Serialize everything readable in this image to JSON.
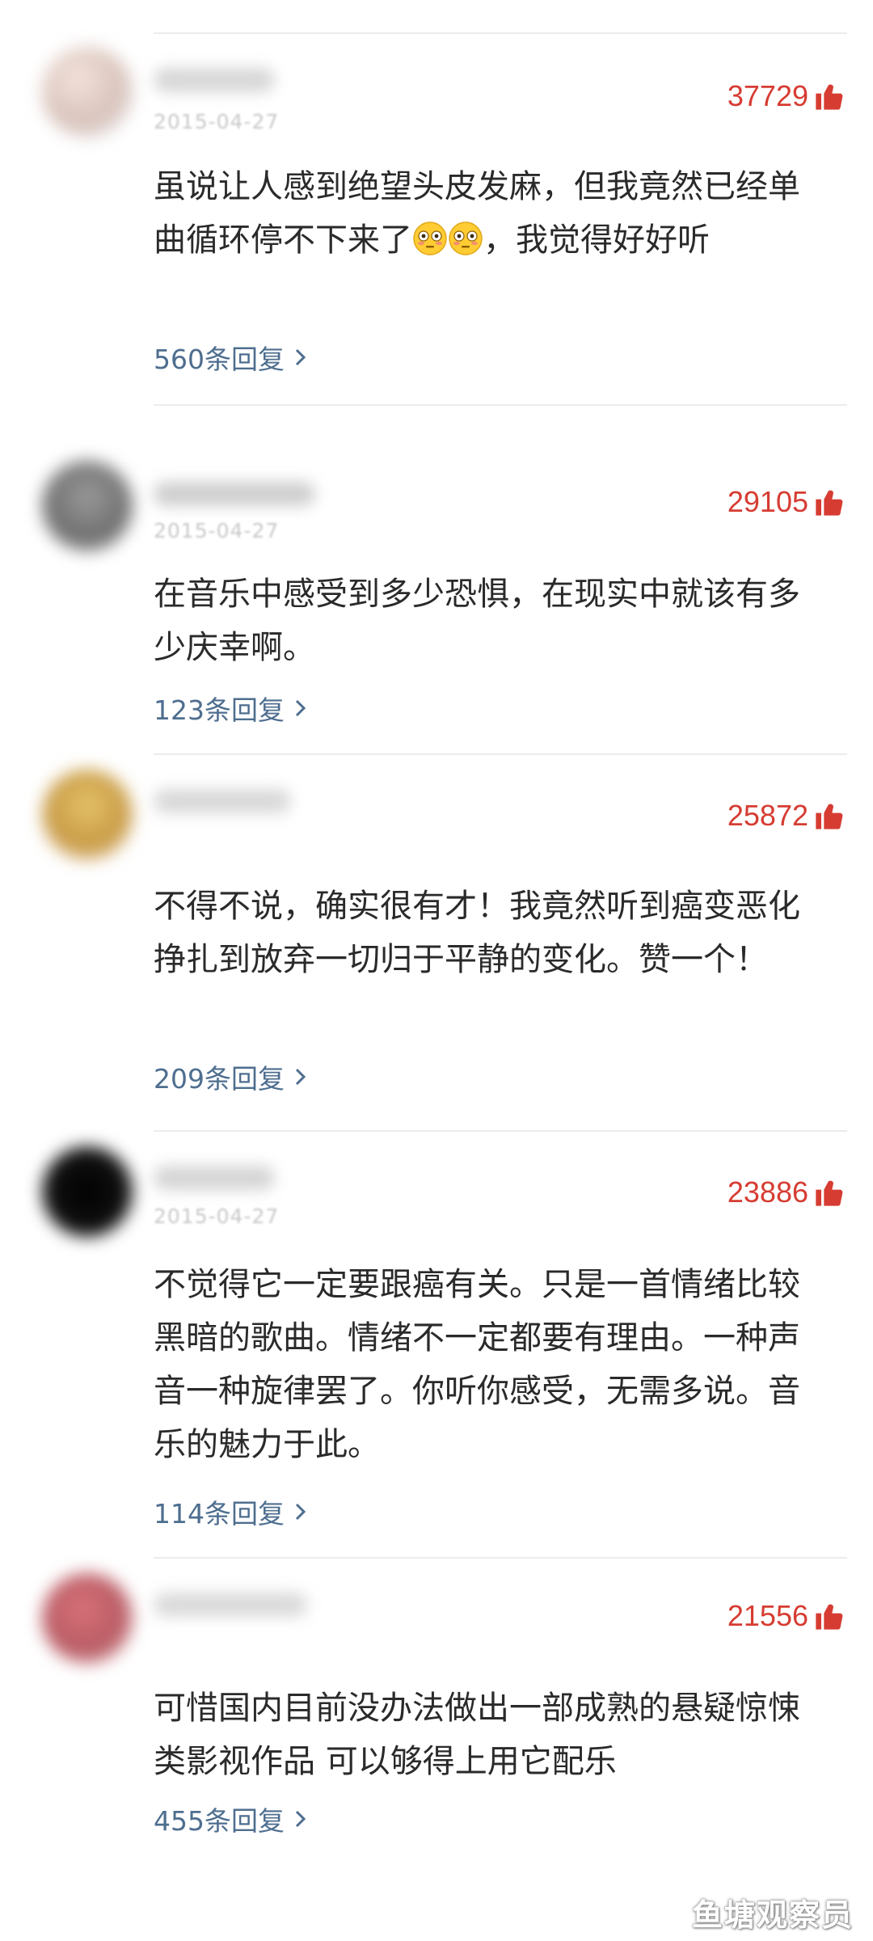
{
  "comments": [
    {
      "likes": "37729",
      "date": "2015-04-27",
      "text": "虽说让人感到绝望头皮发麻，但我竟然已经单曲循环停不下来了",
      "emoji": "flushed-face-emoji",
      "text_tail": "，我觉得好好听",
      "replies": "560条回复"
    },
    {
      "likes": "29105",
      "date": "2015-04-27",
      "text": "在音乐中感受到多少恐惧，在现实中就该有多少庆幸啊。",
      "replies": "123条回复"
    },
    {
      "likes": "25872",
      "date": "",
      "text": "不得不说，确实很有才！我竟然听到癌变恶化挣扎到放弃一切归于平静的变化。赞一个！",
      "replies": "209条回复"
    },
    {
      "likes": "23886",
      "date": "2015-04-27",
      "text": "不觉得它一定要跟癌有关。只是一首情绪比较黑暗的歌曲。情绪不一定都要有理由。一种声音一种旋律罢了。你听你感受，无需多说。音乐的魅力于此。",
      "replies": "114条回复"
    },
    {
      "likes": "21556",
      "date": "",
      "text": "可惜国内目前没办法做出一部成熟的悬疑惊悚类影视作品 可以够得上用它配乐",
      "replies": "455条回复"
    }
  ],
  "watermark": "鱼塘观察员",
  "colors": {
    "like": "#d63c32",
    "reply_link": "#4e6e8f",
    "divider": "#ececec"
  },
  "icons": {
    "like": "thumbs-up-icon",
    "reply_arrow": "chevron-right-icon"
  }
}
